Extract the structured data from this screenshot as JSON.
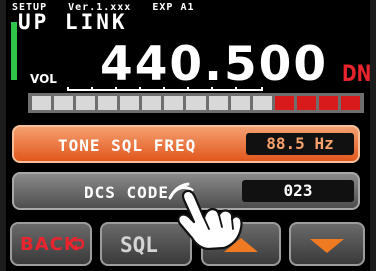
{
  "header": {
    "mode": "SETUP",
    "version": "Ver.1.xxx",
    "ext": "EXP A1"
  },
  "display": {
    "band_label": "UP LINK",
    "vol_label": "VOL",
    "frequency": "440.500",
    "shift_indicator": "DN",
    "vfo_indicator_color": "#2ec44a"
  },
  "meter": {
    "segments_total": 15,
    "segments_red": 4,
    "accent": "#d91a1a"
  },
  "tone_sql": {
    "label": "TONE SQL FREQ",
    "value": "88.5 Hz"
  },
  "dcs": {
    "label": "DCS CODE",
    "value": "023"
  },
  "softkeys": {
    "back": "BACK",
    "sql": "SQL",
    "up_icon": "up-arrow-icon",
    "down_icon": "down-arrow-icon"
  },
  "overlay": {
    "hand_icon": "tapping-hand-icon"
  }
}
